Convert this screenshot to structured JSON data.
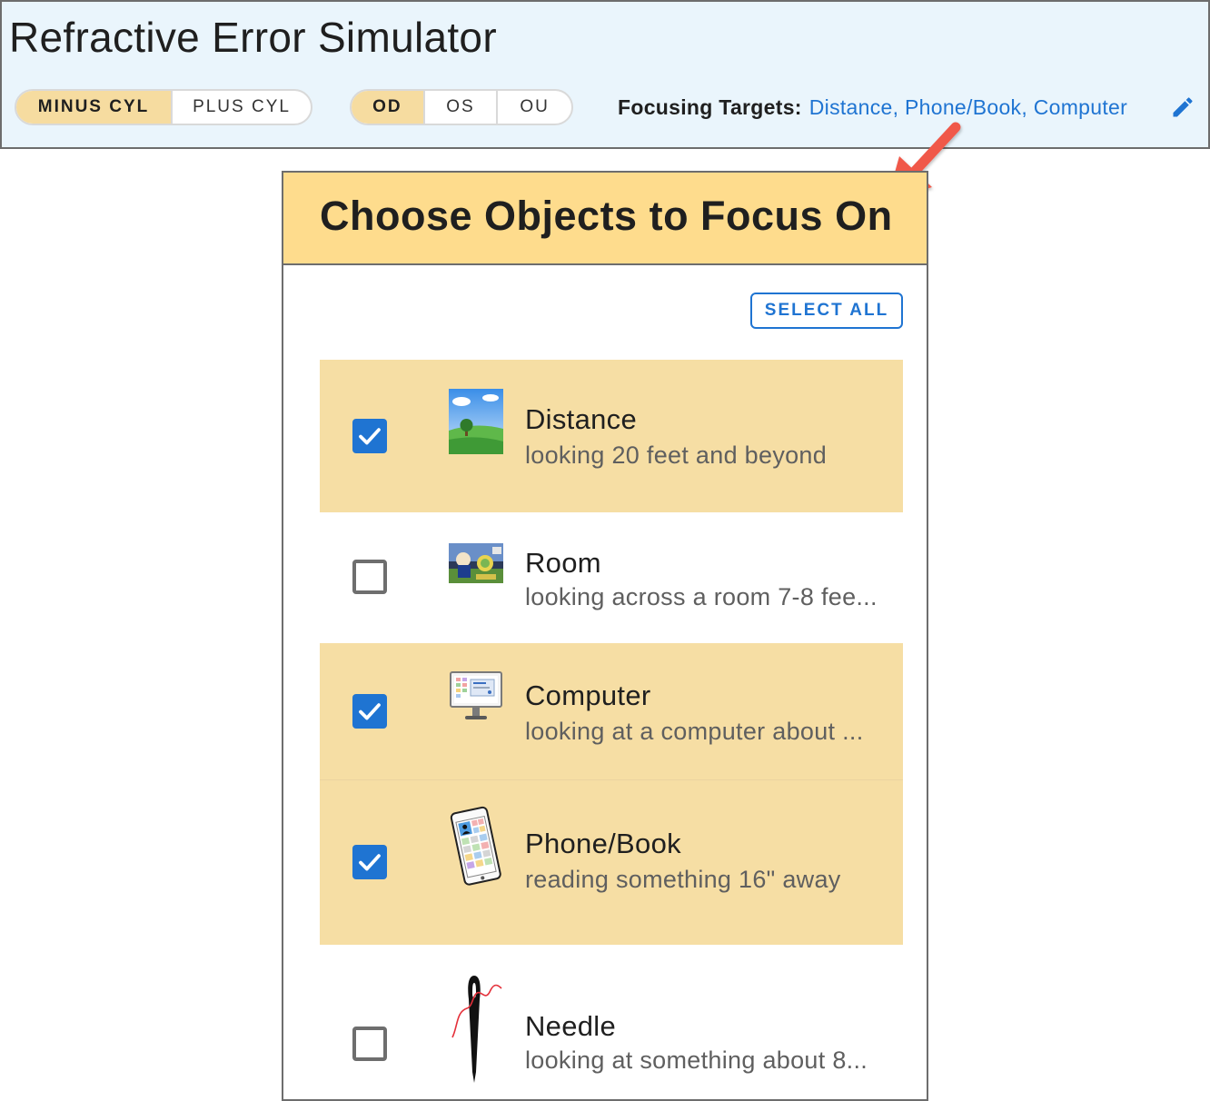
{
  "app": {
    "title": "Refractive Error Simulator"
  },
  "toolbar": {
    "cylinder_options": [
      {
        "label": "MINUS CYL",
        "active": true
      },
      {
        "label": "PLUS CYL",
        "active": false
      }
    ],
    "eye_options": [
      {
        "label": "OD",
        "active": true
      },
      {
        "label": "OS",
        "active": false
      },
      {
        "label": "OU",
        "active": false
      }
    ],
    "focusing_targets_label": "Focusing Targets:",
    "focusing_targets_value": "Distance, Phone/Book, Computer",
    "edit_icon": "pencil-icon"
  },
  "annotation": {
    "arrow_color": "#f0584a"
  },
  "dialog": {
    "title": "Choose Objects to Focus On",
    "select_all_label": "SELECT ALL",
    "items": [
      {
        "title": "Distance",
        "subtitle": "looking 20 feet and beyond",
        "checked": true,
        "icon": "landscape-thumbnail"
      },
      {
        "title": "Room",
        "subtitle": "looking across a room 7-8 fee...",
        "checked": false,
        "icon": "room-tv-thumbnail"
      },
      {
        "title": "Computer",
        "subtitle": "looking at a computer about ...",
        "checked": true,
        "icon": "computer-monitor-thumbnail"
      },
      {
        "title": "Phone/Book",
        "subtitle": "reading something 16\" away",
        "checked": true,
        "icon": "phone-thumbnail"
      },
      {
        "title": "Needle",
        "subtitle": "looking at something about 8...",
        "checked": false,
        "icon": "needle-thread-thumbnail"
      }
    ]
  },
  "colors": {
    "header_bg": "#eaf5fc",
    "dialog_header_bg": "#fedc8d",
    "selected_row_bg": "#f6dea4",
    "toggle_active_bg": "#f6dca0",
    "accent_blue": "#1f74d2"
  }
}
